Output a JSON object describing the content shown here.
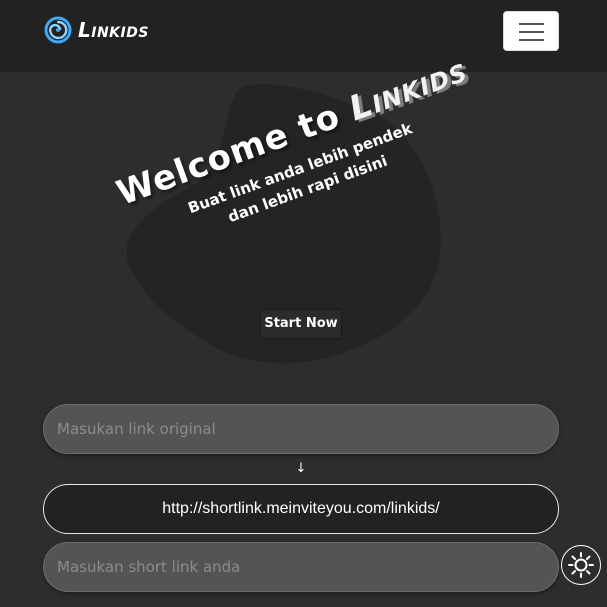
{
  "navbar": {
    "brand_name": "Linkids",
    "brand_icon": "spiral-logo-icon",
    "menu_icon": "hamburger-menu-icon"
  },
  "hero": {
    "welcome_prefix": "Welcome to",
    "welcome_brand": "Linkids",
    "subtitle_line1": "Buat link anda lebih pendek",
    "subtitle_line2": "dan lebih rapi disini",
    "start_button": "Start Now"
  },
  "form": {
    "original_placeholder": "Masukan link original",
    "arrow": "↓",
    "short_prefix": "http://shortlink.meinviteyou.com/linkids/",
    "short_placeholder": "Masukan short link anda"
  },
  "theme_toggle": {
    "icon": "sun-icon"
  },
  "colors": {
    "background": "#2d2d2d",
    "navbar": "#222222",
    "blob": "#242424",
    "logo_accent": "#3fa9f5"
  }
}
